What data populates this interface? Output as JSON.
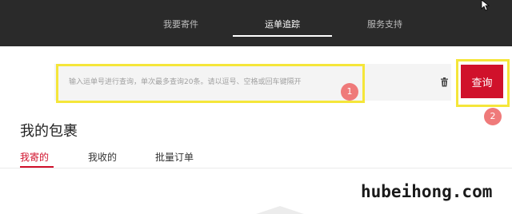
{
  "nav": {
    "tabs": [
      {
        "label": "我要寄件"
      },
      {
        "label": "运单追踪"
      },
      {
        "label": "服务支持"
      }
    ]
  },
  "search": {
    "placeholder": "输入运单号进行查询，单次最多查询20条。请以逗号、空格或回车键隔开",
    "button_label": "查询",
    "clear_icon": "trash-icon"
  },
  "annotations": {
    "badge_1": "1",
    "badge_2": "2"
  },
  "page": {
    "title": "我的包裹",
    "tabs": [
      {
        "label": "我寄的"
      },
      {
        "label": "我收的"
      },
      {
        "label": "批量订单"
      }
    ]
  },
  "watermark": "hubeihong.com",
  "colors": {
    "topbar": "#2a2a2a",
    "accent": "#d0112b",
    "highlight": "#f5e63a",
    "badge": "#ef7a7a"
  }
}
